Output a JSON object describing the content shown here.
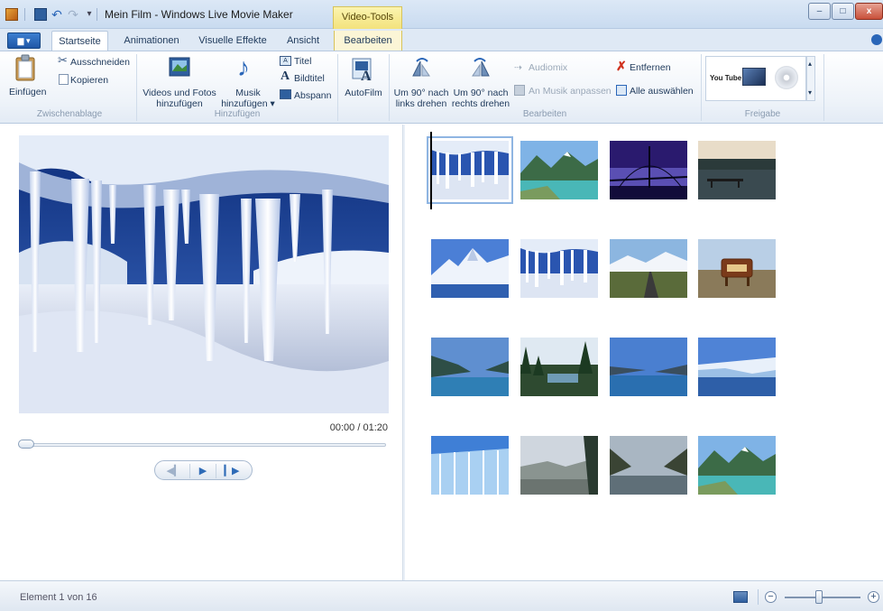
{
  "window": {
    "title": "Mein Film - Windows Live Movie Maker",
    "context_tab_title": "Video-Tools",
    "minimize": "–",
    "maximize": "□",
    "close": "x"
  },
  "quick_access": {
    "undo": "↶",
    "redo": "↷",
    "dropdown": "▾"
  },
  "app_menu": "▆ ▾",
  "tabs": [
    {
      "label": "Startseite",
      "active": true
    },
    {
      "label": "Animationen"
    },
    {
      "label": "Visuelle Effekte"
    },
    {
      "label": "Ansicht"
    },
    {
      "label": "Bearbeiten",
      "contextual": true
    }
  ],
  "ribbon": {
    "groups": {
      "clipboard": "Zwischenablage",
      "add": "Hinzufügen",
      "edit": "Bearbeiten",
      "share": "Freigabe"
    },
    "paste": "Einfügen",
    "cut": "Ausschneiden",
    "copy": "Kopieren",
    "add_videos_line1": "Videos und Fotos",
    "add_videos_line2": "hinzufügen",
    "add_music_line1": "Musik",
    "add_music_line2": "hinzufügen ▾",
    "title": "Titel",
    "caption": "Bildtitel",
    "credits": "Abspann",
    "autofilm": "AutoFilm",
    "rotate_left_line1": "Um 90° nach",
    "rotate_left_line2": "links drehen",
    "rotate_right_line1": "Um 90° nach",
    "rotate_right_line2": "rechts drehen",
    "audiomix": "Audiomix",
    "fit_to_music": "An Musik anpassen",
    "remove": "Entfernen",
    "select_all": "Alle auswählen",
    "youtube": "You Tube",
    "gallery_up": "▴",
    "gallery_more": "▾"
  },
  "player": {
    "time": "00:00 / 01:20",
    "prev": "◀▎",
    "play": "▶",
    "next": "▎▶"
  },
  "storyboard": {
    "items": [
      {
        "scene": "ice-cave",
        "selected": true
      },
      {
        "scene": "mountain-lake"
      },
      {
        "scene": "bridge-dusk"
      },
      {
        "scene": "dock-sunset"
      },
      {
        "scene": "snow-peak"
      },
      {
        "scene": "ice-cave"
      },
      {
        "scene": "mountain-road"
      },
      {
        "scene": "park-sign"
      },
      {
        "scene": "fjord"
      },
      {
        "scene": "forest-lake"
      },
      {
        "scene": "fjord-2"
      },
      {
        "scene": "glacier"
      },
      {
        "scene": "glacier-close"
      },
      {
        "scene": "misty-valley"
      },
      {
        "scene": "lake-valley"
      },
      {
        "scene": "mountain-lake"
      }
    ]
  },
  "status": {
    "text": "Element 1 von 16",
    "zoom_minus": "−",
    "zoom_plus": "+",
    "zoom_level": 0.45
  }
}
